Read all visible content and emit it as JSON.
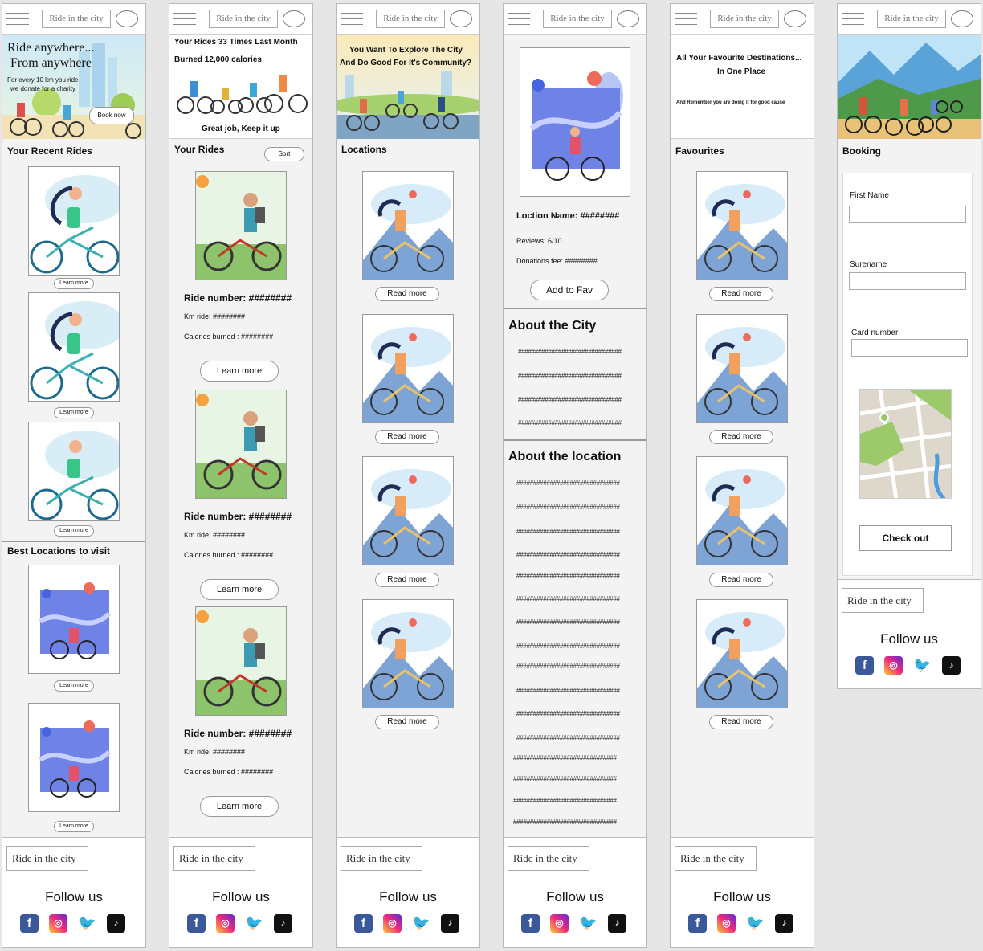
{
  "nav": {
    "brand": "Ride in the city"
  },
  "footer": {
    "brand": "Ride in the city",
    "follow_label": "Follow us",
    "icons": [
      "facebook-icon",
      "instagram-icon",
      "twitter-icon",
      "tiktok-icon"
    ]
  },
  "home": {
    "hero_line1": "Ride anywhere...",
    "hero_line2": "From anywhere",
    "hero_sub1": "For every 10 km you ride",
    "hero_sub2": "we donate for a charity",
    "book_now": "Book now",
    "recent_title": "Your Recent Rides",
    "best_title": "Best Locations to visit",
    "learn_more": "Learn more"
  },
  "rides": {
    "banner_line1": "Your Rides 33 Times Last Month",
    "banner_line2": "Burned 12,000 calories",
    "banner_line3": "Great job, Keep it up",
    "title": "Your Rides",
    "sort": "Sort",
    "ride_number": "Ride number: ########",
    "km": "Km ride: ########",
    "calories": "Calories burned : ########",
    "learn_more": "Learn more"
  },
  "locations": {
    "banner_line1": "You Want To Explore The City",
    "banner_line2": "And Do Good For It's Community?",
    "title": "Locations",
    "read_more": "Read more"
  },
  "detail": {
    "location_name": "Loction Name: ########",
    "reviews": "Reviews: 6/10",
    "donations": "Donations fee: ########",
    "add_fav": "Add to Fav",
    "about_city": "About the City",
    "about_location": "About the location",
    "hash_line": "###############################"
  },
  "favourites": {
    "banner_line1": "All Your Favourite Destinations...",
    "banner_line2": "In One Place",
    "banner_line3": "And Remember you are doing it for good cause",
    "title": "Favourites",
    "read_more": "Read more"
  },
  "booking": {
    "title": "Booking",
    "first_name": "First Name",
    "surname": "Surename",
    "card_number": "Card number",
    "checkout": "Check out"
  }
}
